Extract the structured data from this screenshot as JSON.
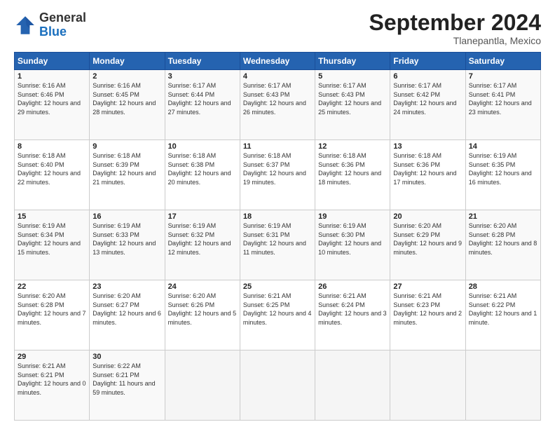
{
  "header": {
    "logo_general": "General",
    "logo_blue": "Blue",
    "month_title": "September 2024",
    "location": "Tlanepantla, Mexico"
  },
  "days_of_week": [
    "Sunday",
    "Monday",
    "Tuesday",
    "Wednesday",
    "Thursday",
    "Friday",
    "Saturday"
  ],
  "weeks": [
    [
      {
        "num": "1",
        "sunrise": "6:16 AM",
        "sunset": "6:46 PM",
        "daylight": "12 hours and 29 minutes."
      },
      {
        "num": "2",
        "sunrise": "6:16 AM",
        "sunset": "6:45 PM",
        "daylight": "12 hours and 28 minutes."
      },
      {
        "num": "3",
        "sunrise": "6:17 AM",
        "sunset": "6:44 PM",
        "daylight": "12 hours and 27 minutes."
      },
      {
        "num": "4",
        "sunrise": "6:17 AM",
        "sunset": "6:43 PM",
        "daylight": "12 hours and 26 minutes."
      },
      {
        "num": "5",
        "sunrise": "6:17 AM",
        "sunset": "6:43 PM",
        "daylight": "12 hours and 25 minutes."
      },
      {
        "num": "6",
        "sunrise": "6:17 AM",
        "sunset": "6:42 PM",
        "daylight": "12 hours and 24 minutes."
      },
      {
        "num": "7",
        "sunrise": "6:17 AM",
        "sunset": "6:41 PM",
        "daylight": "12 hours and 23 minutes."
      }
    ],
    [
      {
        "num": "8",
        "sunrise": "6:18 AM",
        "sunset": "6:40 PM",
        "daylight": "12 hours and 22 minutes."
      },
      {
        "num": "9",
        "sunrise": "6:18 AM",
        "sunset": "6:39 PM",
        "daylight": "12 hours and 21 minutes."
      },
      {
        "num": "10",
        "sunrise": "6:18 AM",
        "sunset": "6:38 PM",
        "daylight": "12 hours and 20 minutes."
      },
      {
        "num": "11",
        "sunrise": "6:18 AM",
        "sunset": "6:37 PM",
        "daylight": "12 hours and 19 minutes."
      },
      {
        "num": "12",
        "sunrise": "6:18 AM",
        "sunset": "6:36 PM",
        "daylight": "12 hours and 18 minutes."
      },
      {
        "num": "13",
        "sunrise": "6:18 AM",
        "sunset": "6:36 PM",
        "daylight": "12 hours and 17 minutes."
      },
      {
        "num": "14",
        "sunrise": "6:19 AM",
        "sunset": "6:35 PM",
        "daylight": "12 hours and 16 minutes."
      }
    ],
    [
      {
        "num": "15",
        "sunrise": "6:19 AM",
        "sunset": "6:34 PM",
        "daylight": "12 hours and 15 minutes."
      },
      {
        "num": "16",
        "sunrise": "6:19 AM",
        "sunset": "6:33 PM",
        "daylight": "12 hours and 13 minutes."
      },
      {
        "num": "17",
        "sunrise": "6:19 AM",
        "sunset": "6:32 PM",
        "daylight": "12 hours and 12 minutes."
      },
      {
        "num": "18",
        "sunrise": "6:19 AM",
        "sunset": "6:31 PM",
        "daylight": "12 hours and 11 minutes."
      },
      {
        "num": "19",
        "sunrise": "6:19 AM",
        "sunset": "6:30 PM",
        "daylight": "12 hours and 10 minutes."
      },
      {
        "num": "20",
        "sunrise": "6:20 AM",
        "sunset": "6:29 PM",
        "daylight": "12 hours and 9 minutes."
      },
      {
        "num": "21",
        "sunrise": "6:20 AM",
        "sunset": "6:28 PM",
        "daylight": "12 hours and 8 minutes."
      }
    ],
    [
      {
        "num": "22",
        "sunrise": "6:20 AM",
        "sunset": "6:28 PM",
        "daylight": "12 hours and 7 minutes."
      },
      {
        "num": "23",
        "sunrise": "6:20 AM",
        "sunset": "6:27 PM",
        "daylight": "12 hours and 6 minutes."
      },
      {
        "num": "24",
        "sunrise": "6:20 AM",
        "sunset": "6:26 PM",
        "daylight": "12 hours and 5 minutes."
      },
      {
        "num": "25",
        "sunrise": "6:21 AM",
        "sunset": "6:25 PM",
        "daylight": "12 hours and 4 minutes."
      },
      {
        "num": "26",
        "sunrise": "6:21 AM",
        "sunset": "6:24 PM",
        "daylight": "12 hours and 3 minutes."
      },
      {
        "num": "27",
        "sunrise": "6:21 AM",
        "sunset": "6:23 PM",
        "daylight": "12 hours and 2 minutes."
      },
      {
        "num": "28",
        "sunrise": "6:21 AM",
        "sunset": "6:22 PM",
        "daylight": "12 hours and 1 minute."
      }
    ],
    [
      {
        "num": "29",
        "sunrise": "6:21 AM",
        "sunset": "6:21 PM",
        "daylight": "12 hours and 0 minutes."
      },
      {
        "num": "30",
        "sunrise": "6:22 AM",
        "sunset": "6:21 PM",
        "daylight": "11 hours and 59 minutes."
      },
      null,
      null,
      null,
      null,
      null
    ]
  ]
}
